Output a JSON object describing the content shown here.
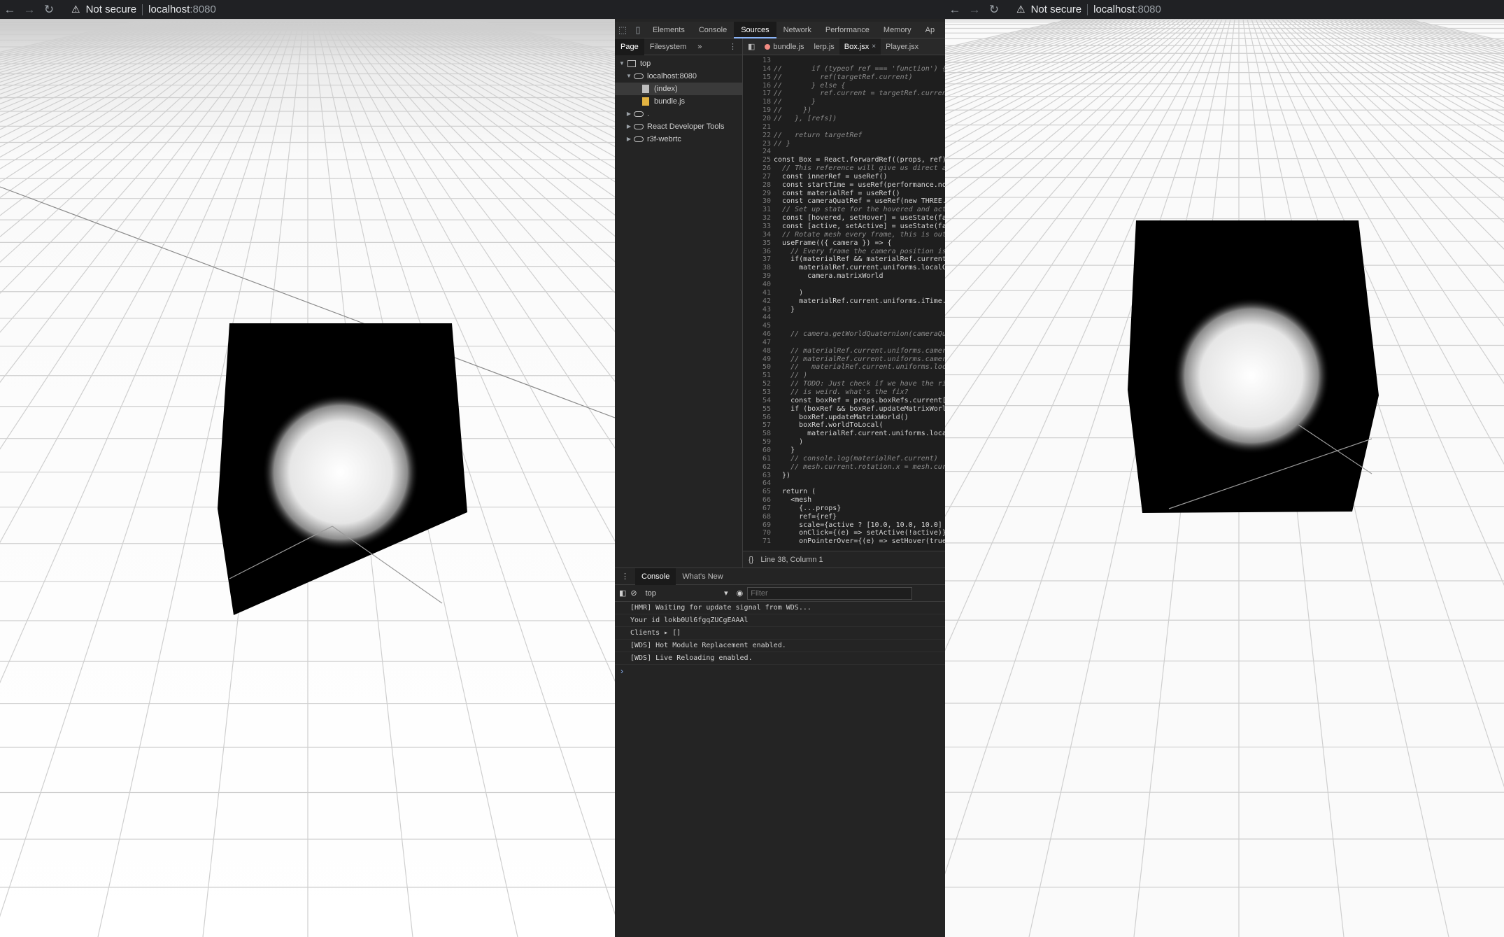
{
  "left_browser": {
    "security_text": "Not secure",
    "host": "localhost",
    "port": ":8080",
    "back_glyph": "←",
    "forward_glyph": "→",
    "reload_glyph": "↻",
    "warning_glyph": "⚠"
  },
  "right_browser": {
    "security_text": "Not secure",
    "host": "localhost",
    "port": ":8080",
    "back_glyph": "←",
    "forward_glyph": "→",
    "reload_glyph": "↻",
    "warning_glyph": "⚠"
  },
  "devtools": {
    "tool_icons": [
      "inspect-icon",
      "device-toolbar-icon"
    ],
    "main_tabs": [
      "Elements",
      "Console",
      "Sources",
      "Network",
      "Performance",
      "Memory",
      "Ap"
    ],
    "active_main_tab": "Sources",
    "navigator": {
      "tabs": [
        "Page",
        "Filesystem"
      ],
      "more_glyph": "»",
      "menu_glyph": "⋮",
      "tree": [
        {
          "label": "top",
          "icon": "frame-icon",
          "expanded": true
        },
        {
          "label": "localhost:8080",
          "icon": "cloud-icon",
          "expanded": true
        },
        {
          "label": "(index)",
          "icon": "file-icon",
          "selected": true
        },
        {
          "label": "bundle.js",
          "icon": "js-file-icon"
        },
        {
          "label": ".",
          "icon": "cloud-icon",
          "expanded": false
        },
        {
          "label": "React Developer Tools",
          "icon": "cloud-icon",
          "expanded": false
        },
        {
          "label": "r3f-webrtc",
          "icon": "cloud-icon",
          "expanded": false
        }
      ]
    },
    "editor": {
      "tabs": [
        {
          "label": "bundle.js",
          "error": true
        },
        {
          "label": "lerp.js"
        },
        {
          "label": "Box.jsx",
          "active": true,
          "closable": true
        },
        {
          "label": "Player.jsx"
        }
      ],
      "close_glyph": "×",
      "lines": [
        {
          "n": "13",
          "t": ""
        },
        {
          "n": "14",
          "t": "//       if (typeof ref === 'function') {",
          "c": true
        },
        {
          "n": "15",
          "t": "//         ref(targetRef.current)",
          "c": true
        },
        {
          "n": "16",
          "t": "//       } else {",
          "c": true
        },
        {
          "n": "17",
          "t": "//         ref.current = targetRef.current",
          "c": true
        },
        {
          "n": "18",
          "t": "//       }",
          "c": true
        },
        {
          "n": "19",
          "t": "//     })",
          "c": true
        },
        {
          "n": "20",
          "t": "//   }, [refs])",
          "c": true
        },
        {
          "n": "21",
          "t": ""
        },
        {
          "n": "22",
          "t": "//   return targetRef",
          "c": true
        },
        {
          "n": "23",
          "t": "// }",
          "c": true
        },
        {
          "n": "24",
          "t": ""
        },
        {
          "n": "25",
          "t": "const Box = React.forwardRef((props, ref) =>"
        },
        {
          "n": "26",
          "t": "  // This reference will give us direct a",
          "c": true
        },
        {
          "n": "27",
          "t": "  const innerRef = useRef()"
        },
        {
          "n": "28",
          "t": "  const startTime = useRef(performance.now"
        },
        {
          "n": "29",
          "t": "  const materialRef = useRef()"
        },
        {
          "n": "30",
          "t": "  const cameraQuatRef = useRef(new THREE.Q"
        },
        {
          "n": "31",
          "t": "  // Set up state for the hovered and acti",
          "c": true
        },
        {
          "n": "32",
          "t": "  const [hovered, setHover] = useState(fal"
        },
        {
          "n": "33",
          "t": "  const [active, setActive] = useState(fal"
        },
        {
          "n": "34",
          "t": "  // Rotate mesh every frame, this is out",
          "c": true
        },
        {
          "n": "35",
          "t": "  useFrame(({ camera }) => {"
        },
        {
          "n": "36",
          "t": "    // Every frame the camera position is",
          "c": true
        },
        {
          "n": "37",
          "t": "    if(materialRef && materialRef.current)"
        },
        {
          "n": "38",
          "t": "      materialRef.current.uniforms.localCa"
        },
        {
          "n": "39",
          "t": "        camera.matrixWorld"
        },
        {
          "n": "40",
          "t": ""
        },
        {
          "n": "41",
          "t": "      )"
        },
        {
          "n": "42",
          "t": "      materialRef.current.uniforms.iTime.v"
        },
        {
          "n": "43",
          "t": "    }"
        },
        {
          "n": "44",
          "t": ""
        },
        {
          "n": "45",
          "t": ""
        },
        {
          "n": "46",
          "t": "    // camera.getWorldQuaternion(cameraQua",
          "c": true
        },
        {
          "n": "47",
          "t": ""
        },
        {
          "n": "48",
          "t": "    // materialRef.current.uniforms.camera",
          "c": true
        },
        {
          "n": "49",
          "t": "    // materialRef.current.uniforms.camera",
          "c": true
        },
        {
          "n": "50",
          "t": "    //   materialRef.current.uniforms.loca",
          "c": true
        },
        {
          "n": "51",
          "t": "    // )",
          "c": true
        },
        {
          "n": "52",
          "t": "    // TODO: Just check if we have the ri",
          "c": true
        },
        {
          "n": "53",
          "t": "    // is weird. what's the fix?",
          "c": true
        },
        {
          "n": "54",
          "t": "    const boxRef = props.boxRefs.current[p"
        },
        {
          "n": "55",
          "t": "    if (boxRef && boxRef.updateMatrixWorld"
        },
        {
          "n": "56",
          "t": "      boxRef.updateMatrixWorld()"
        },
        {
          "n": "57",
          "t": "      boxRef.worldToLocal("
        },
        {
          "n": "58",
          "t": "        materialRef.current.uniforms.local"
        },
        {
          "n": "59",
          "t": "      )"
        },
        {
          "n": "60",
          "t": "    }"
        },
        {
          "n": "61",
          "t": "    // console.log(materialRef.current)",
          "c": true
        },
        {
          "n": "62",
          "t": "    // mesh.current.rotation.x = mesh.curr",
          "c": true
        },
        {
          "n": "63",
          "t": "  })"
        },
        {
          "n": "64",
          "t": ""
        },
        {
          "n": "65",
          "t": "  return ("
        },
        {
          "n": "66",
          "t": "    <mesh"
        },
        {
          "n": "67",
          "t": "      {...props}"
        },
        {
          "n": "68",
          "t": "      ref={ref}"
        },
        {
          "n": "69",
          "t": "      scale={active ? [10.0, 10.0, 10.0]"
        },
        {
          "n": "70",
          "t": "      onClick={(e) => setActive(!active)}"
        },
        {
          "n": "71",
          "t": "      onPointerOver={(e) => setHover(true"
        },
        {
          "n": "72",
          "t": "      onPointerOut={(e) => setHover(false"
        }
      ],
      "format_glyph": "{}",
      "status": "Line 38, Column 1"
    },
    "drawer": {
      "menu_glyph": "⋮",
      "tabs": [
        "Console",
        "What's New"
      ],
      "context": "top",
      "context_arrow": "▾",
      "filter_placeholder": "Filter",
      "messages": [
        "[HMR] Waiting for update signal from WDS...",
        "Your id lokb0Ul6fgqZUCgEAAAl",
        "Clients ▸ []",
        "[WDS] Hot Module Replacement enabled.",
        "[WDS] Live Reloading enabled."
      ],
      "prompt_glyph": "›"
    }
  }
}
